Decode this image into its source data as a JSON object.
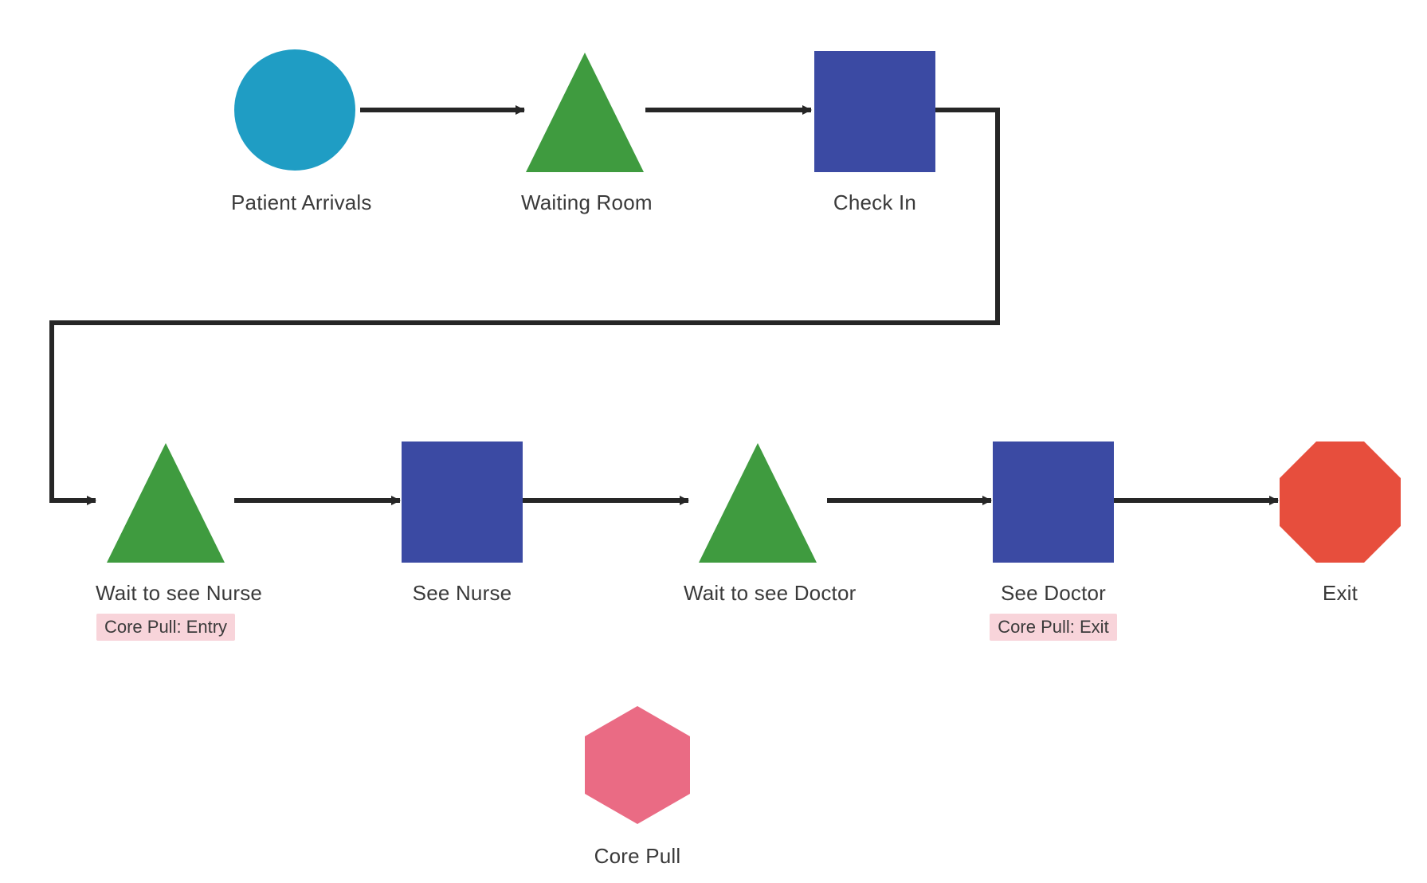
{
  "colors": {
    "teal": "#1f9dc4",
    "green": "#3f9b3f",
    "blue": "#3b4aa3",
    "red": "#e74e3d",
    "pink": "#ea6b84",
    "tagbg": "#f8d4da",
    "arrow": "#262626",
    "text": "#3a3a3a"
  },
  "nodes": {
    "patient_arrivals": {
      "label": "Patient Arrivals"
    },
    "waiting_room": {
      "label": "Waiting Room"
    },
    "check_in": {
      "label": "Check In"
    },
    "wait_nurse": {
      "label": "Wait to see Nurse",
      "tag": "Core Pull: Entry"
    },
    "see_nurse": {
      "label": "See Nurse"
    },
    "wait_doctor": {
      "label": "Wait to see Doctor"
    },
    "see_doctor": {
      "label": "See Doctor",
      "tag": "Core Pull: Exit"
    },
    "exit": {
      "label": "Exit"
    },
    "core_pull": {
      "label": "Core Pull"
    }
  },
  "edges": [
    {
      "from": "patient_arrivals",
      "to": "waiting_room"
    },
    {
      "from": "waiting_room",
      "to": "check_in"
    },
    {
      "from": "check_in",
      "to": "wait_nurse"
    },
    {
      "from": "wait_nurse",
      "to": "see_nurse"
    },
    {
      "from": "see_nurse",
      "to": "wait_doctor"
    },
    {
      "from": "wait_doctor",
      "to": "see_doctor"
    },
    {
      "from": "see_doctor",
      "to": "exit"
    }
  ]
}
